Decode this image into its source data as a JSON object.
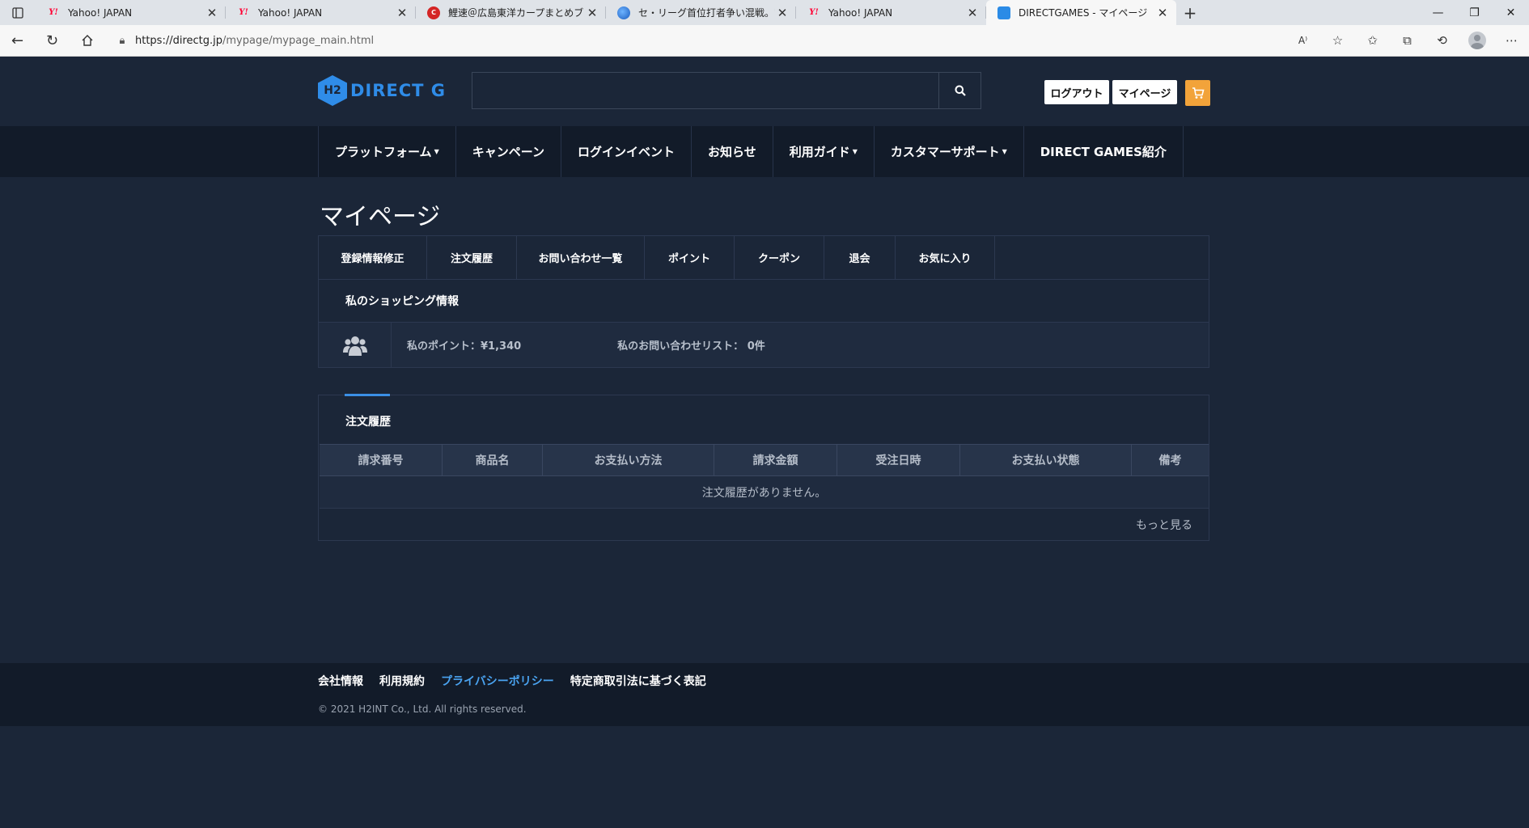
{
  "browser": {
    "tabs": [
      {
        "title": "Yahoo! JAPAN",
        "icon": "yahoo-icon",
        "active": false
      },
      {
        "title": "Yahoo! JAPAN",
        "icon": "yahoo-icon",
        "active": false
      },
      {
        "title": "鯉速＠広島東洋カープまとめブログ",
        "icon": "carp-icon",
        "active": false
      },
      {
        "title": "セ・リーグ首位打者争い混戦。宮崎",
        "icon": "globe-icon",
        "active": false
      },
      {
        "title": "Yahoo! JAPAN",
        "icon": "yahoo-icon",
        "active": false
      },
      {
        "title": "DIRECTGAMES - マイページ",
        "icon": "directgames-icon",
        "active": true
      }
    ],
    "url_domain": "https://directg.jp",
    "url_path": "/mypage/mypage_main.html"
  },
  "header": {
    "logo_text": "DIRECT G",
    "logo_mark": "H2",
    "search_placeholder": "",
    "logout_label": "ログアウト",
    "mypage_label": "マイページ"
  },
  "nav": {
    "items": [
      {
        "label": "プラットフォーム",
        "dropdown": true
      },
      {
        "label": "キャンペーン",
        "dropdown": false
      },
      {
        "label": "ログインイベント",
        "dropdown": false
      },
      {
        "label": "お知らせ",
        "dropdown": false
      },
      {
        "label": "利用ガイド",
        "dropdown": true
      },
      {
        "label": "カスタマーサポート",
        "dropdown": true
      },
      {
        "label": "DIRECT GAMES紹介",
        "dropdown": false
      }
    ]
  },
  "page": {
    "title": "マイページ",
    "subtabs": [
      "登録情報修正",
      "注文履歴",
      "お問い合わせ一覧",
      "ポイント",
      "クーポン",
      "退会",
      "お気に入り"
    ],
    "shopping_info_title": "私のショッピング情報",
    "points_text": "私のポイント：¥1,340",
    "inquiries_text": "私のお問い合わせリスト： 0件"
  },
  "orders": {
    "title": "注文履歴",
    "columns": [
      "請求番号",
      "商品名",
      "お支払い方法",
      "請求金額",
      "受注日時",
      "お支払い状態",
      "備考"
    ],
    "empty_text": "注文履歴がありません。",
    "more_label": "もっと見る"
  },
  "footer": {
    "links": [
      "会社情報",
      "利用規約",
      "プライバシーポリシー",
      "特定商取引法に基づく表記"
    ],
    "copyright": "© 2021 H2INT Co., Ltd. All rights reserved."
  },
  "colors": {
    "background": "#1b2638",
    "nav_background": "#121b29",
    "accent_blue": "#2f8ce8",
    "cart_orange": "#f2a33a",
    "footer_link_highlight": "#4aa3f0"
  }
}
